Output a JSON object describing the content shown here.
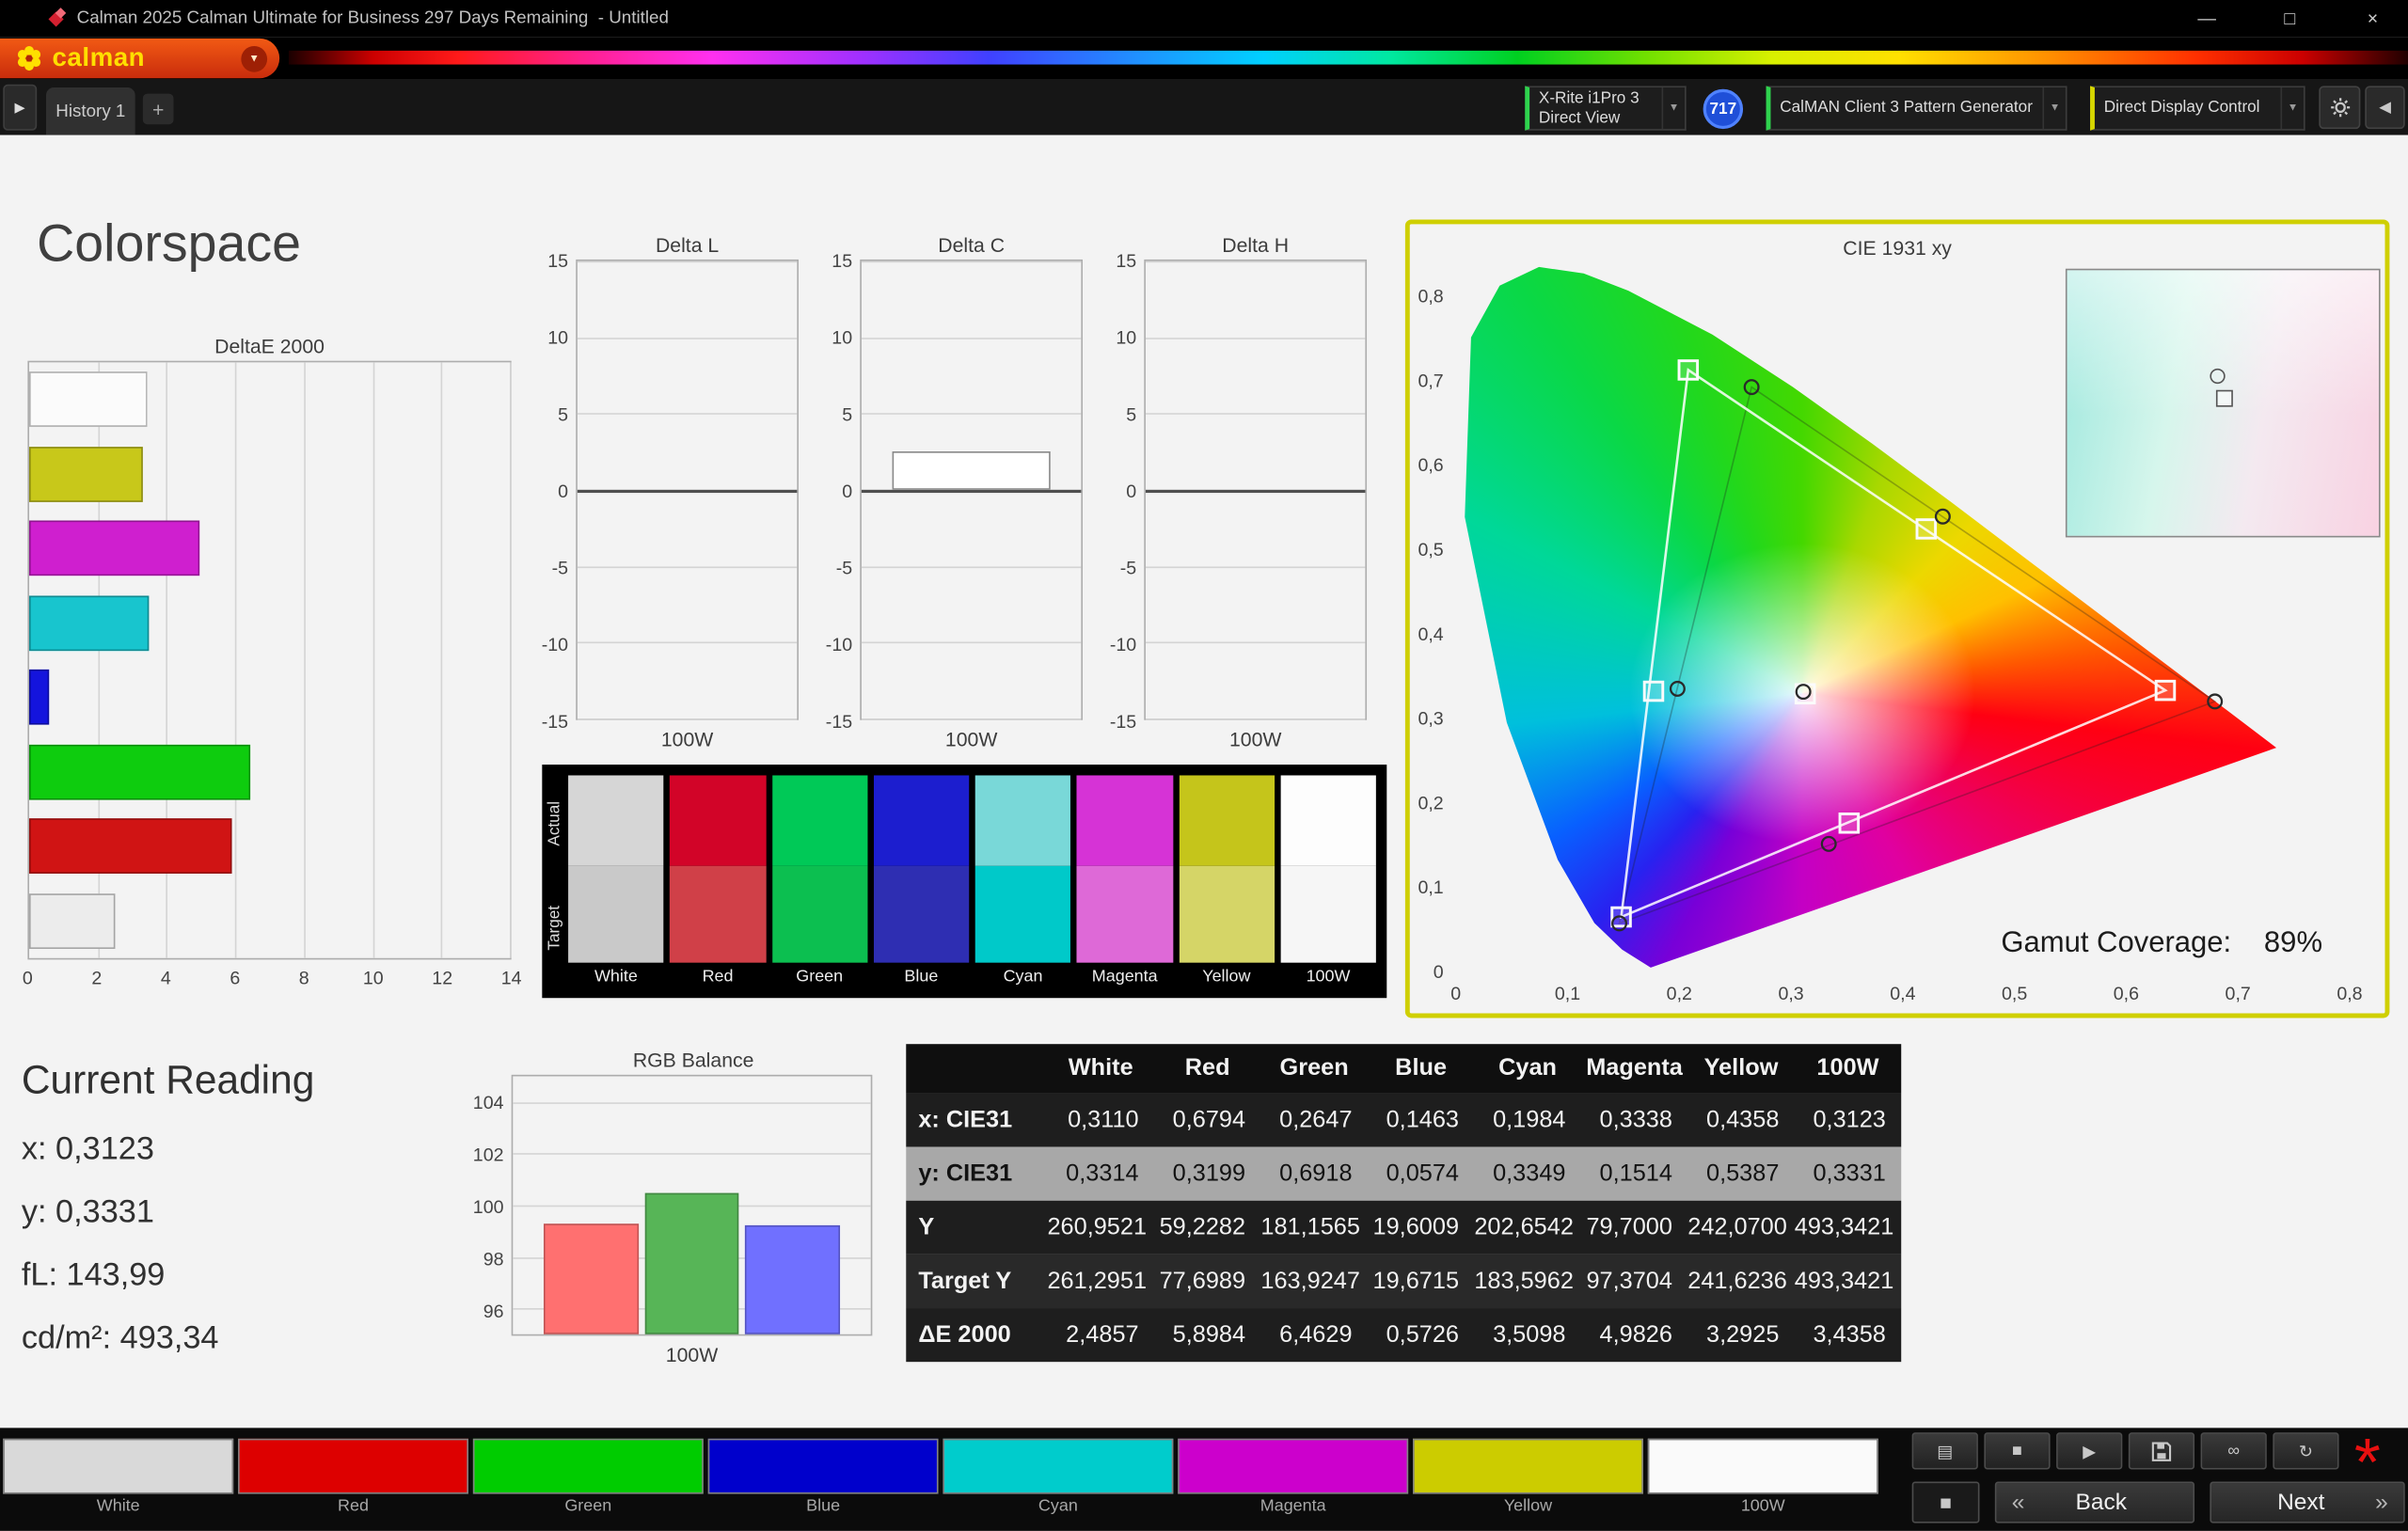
{
  "window": {
    "title": "Calman 2025 Calman Ultimate for Business 297 Days Remaining  - Untitled"
  },
  "brand": {
    "logo_text": "calman"
  },
  "tab_bar": {
    "tab": "History 1",
    "add": "+"
  },
  "toolbar": {
    "meter_line1": "X-Rite i1Pro 3",
    "meter_line2": "Direct View",
    "badge": "717",
    "pattern_gen": "CalMAN Client 3 Pattern Generator",
    "display_ctrl": "Direct Display Control"
  },
  "page_title": "Colorspace",
  "current_reading": {
    "title": "Current Reading",
    "x": "x: 0,3123",
    "y": "y: 0,3331",
    "fl": "fL: 143,99",
    "cdm2": "cd/m²: 493,34"
  },
  "swatch_panel": {
    "row_labels": [
      "Actual",
      "Target"
    ],
    "swatches": [
      {
        "label": "White",
        "actual": "#d6d6d6",
        "target": "#c9c9c9"
      },
      {
        "label": "Red",
        "actual": "#d20428",
        "target": "#d04048"
      },
      {
        "label": "Green",
        "actual": "#00c957",
        "target": "#0cbf50"
      },
      {
        "label": "Blue",
        "actual": "#1c1ecf",
        "target": "#2e2eb2"
      },
      {
        "label": "Cyan",
        "actual": "#79d8d8",
        "target": "#00c9c9"
      },
      {
        "label": "Magenta",
        "actual": "#d633d6",
        "target": "#de69d7"
      },
      {
        "label": "Yellow",
        "actual": "#c5c51b",
        "target": "#d5d567"
      },
      {
        "label": "100W",
        "actual": "#fdfdfd",
        "target": "#f6f6f6"
      }
    ]
  },
  "bottom_bar": {
    "patterns": [
      {
        "label": "White",
        "color": "#d9d9d9"
      },
      {
        "label": "Red",
        "color": "#dd0000"
      },
      {
        "label": "Green",
        "color": "#00cc00"
      },
      {
        "label": "Blue",
        "color": "#0000cc"
      },
      {
        "label": "Cyan",
        "color": "#00cccc"
      },
      {
        "label": "Magenta",
        "color": "#cc00cc"
      },
      {
        "label": "Yellow",
        "color": "#cccc00"
      },
      {
        "label": "100W",
        "color": "#fafafa"
      }
    ],
    "back": "Back",
    "next": "Next"
  },
  "icons": {
    "minimize": "—",
    "maximize": "□",
    "close": "×",
    "dropdown_caret": "▼",
    "logo_caret": "▼",
    "expand": "▶",
    "collapse": "◀",
    "stop": "■",
    "play": "▶",
    "continuous": "∞",
    "refresh": "↻",
    "pattern_window": "▤",
    "display_square": "■",
    "back_chevron": "«",
    "next_chevron": "»",
    "asterisk": "*"
  },
  "chart_data": [
    {
      "id": "deltae2000",
      "type": "bar",
      "title": "DeltaE 2000",
      "orientation": "horizontal",
      "xlim": [
        0,
        14
      ],
      "xticks": [
        0,
        2,
        4,
        6,
        8,
        10,
        12,
        14
      ],
      "bars": [
        {
          "name": "100W",
          "value": 3.4358,
          "color": "#fbfbfb"
        },
        {
          "name": "Yellow",
          "value": 3.2925,
          "color": "#c8c81a"
        },
        {
          "name": "Magenta",
          "value": 4.9826,
          "color": "#cf1fcf"
        },
        {
          "name": "Cyan",
          "value": 3.5098,
          "color": "#18c5ce"
        },
        {
          "name": "Blue",
          "value": 0.5726,
          "color": "#1414dd"
        },
        {
          "name": "Green",
          "value": 6.4629,
          "color": "#0ecc0e"
        },
        {
          "name": "Red",
          "value": 5.8984,
          "color": "#d01414"
        },
        {
          "name": "White",
          "value": 2.4857,
          "color": "#ececec"
        }
      ]
    },
    {
      "id": "delta_l",
      "type": "bar",
      "title": "Delta L",
      "ylim": [
        -15,
        15
      ],
      "yticks": [
        15,
        10,
        5,
        0,
        -5,
        -10,
        -15
      ],
      "categories": [
        "100W"
      ],
      "values": [
        0
      ]
    },
    {
      "id": "delta_c",
      "type": "bar",
      "title": "Delta C",
      "ylim": [
        -15,
        15
      ],
      "yticks": [
        15,
        10,
        5,
        0,
        -5,
        -10,
        -15
      ],
      "categories": [
        "100W"
      ],
      "values": [
        2.5
      ]
    },
    {
      "id": "delta_h",
      "type": "bar",
      "title": "Delta H",
      "ylim": [
        -15,
        15
      ],
      "yticks": [
        15,
        10,
        5,
        0,
        -5,
        -10,
        -15
      ],
      "categories": [
        "100W"
      ],
      "values": [
        0
      ]
    },
    {
      "id": "rgb_balance",
      "type": "bar",
      "title": "RGB Balance",
      "ylim": [
        95,
        105
      ],
      "yticks": [
        104,
        102,
        100,
        98,
        96
      ],
      "categories": [
        "Red",
        "Green",
        "Blue"
      ],
      "values": [
        99.3,
        100.5,
        99.2
      ],
      "colors": [
        "#ff7070",
        "#57b557",
        "#7070ff"
      ],
      "xlabel": "100W"
    },
    {
      "id": "cie1931",
      "type": "scatter",
      "title": "CIE 1931 xy",
      "xlim": [
        0,
        0.8
      ],
      "ylim": [
        0,
        0.85
      ],
      "xticks": [
        "0",
        "0,1",
        "0,2",
        "0,3",
        "0,4",
        "0,5",
        "0,6",
        "0,7",
        "0,8"
      ],
      "yticks": [
        "0,8",
        "0,7",
        "0,6",
        "0,5",
        "0,4",
        "0,3",
        "0,2",
        "0,1",
        "0"
      ],
      "gamut_label": "Gamut Coverage:",
      "gamut_value": "89%",
      "measured": [
        {
          "name": "White",
          "x": 0.311,
          "y": 0.3314
        },
        {
          "name": "Red",
          "x": 0.6794,
          "y": 0.3199
        },
        {
          "name": "Green",
          "x": 0.2647,
          "y": 0.6918
        },
        {
          "name": "Blue",
          "x": 0.1463,
          "y": 0.0574
        },
        {
          "name": "Cyan",
          "x": 0.1984,
          "y": 0.3349
        },
        {
          "name": "Magenta",
          "x": 0.3338,
          "y": 0.1514
        },
        {
          "name": "Yellow",
          "x": 0.4358,
          "y": 0.5387
        }
      ],
      "targets": [
        {
          "name": "White",
          "x": 0.3127,
          "y": 0.329
        },
        {
          "name": "Red",
          "x": 0.635,
          "y": 0.333
        },
        {
          "name": "Green",
          "x": 0.208,
          "y": 0.712
        },
        {
          "name": "Blue",
          "x": 0.148,
          "y": 0.065
        },
        {
          "name": "Cyan",
          "x": 0.177,
          "y": 0.332
        },
        {
          "name": "Magenta",
          "x": 0.352,
          "y": 0.176
        },
        {
          "name": "Yellow",
          "x": 0.421,
          "y": 0.524
        }
      ]
    },
    {
      "id": "results_table",
      "type": "table",
      "columns": [
        "",
        "White",
        "Red",
        "Green",
        "Blue",
        "Cyan",
        "Magenta",
        "Yellow",
        "100W"
      ],
      "rows": [
        {
          "label": "x: CIE31",
          "values": [
            "0,3110",
            "0,6794",
            "0,2647",
            "0,1463",
            "0,1984",
            "0,3338",
            "0,4358",
            "0,3123"
          ]
        },
        {
          "label": "y: CIE31",
          "values": [
            "0,3314",
            "0,3199",
            "0,6918",
            "0,0574",
            "0,3349",
            "0,1514",
            "0,5387",
            "0,3331"
          ],
          "highlight": true
        },
        {
          "label": "Y",
          "values": [
            "260,9521",
            "59,2282",
            "181,1565",
            "19,6009",
            "202,6542",
            "79,7000",
            "242,0700",
            "493,3421"
          ]
        },
        {
          "label": "Target Y",
          "values": [
            "261,2951",
            "77,6989",
            "163,9247",
            "19,6715",
            "183,5962",
            "97,3704",
            "241,6236",
            "493,3421"
          ]
        },
        {
          "label": "ΔE 2000",
          "values": [
            "2,4857",
            "5,8984",
            "6,4629",
            "0,5726",
            "3,5098",
            "4,9826",
            "3,2925",
            "3,4358"
          ]
        }
      ]
    }
  ]
}
